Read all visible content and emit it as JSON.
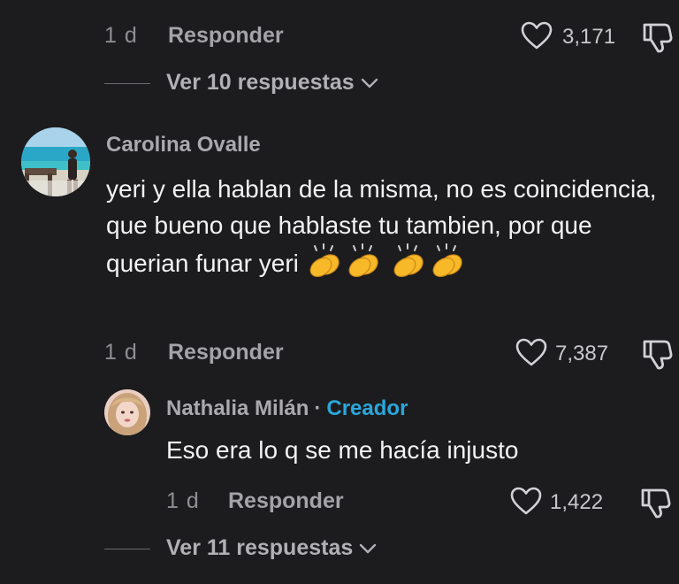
{
  "top_actions": {
    "time": "1 d",
    "reply_label": "Responder",
    "like_count": "3,171"
  },
  "view_replies_1": {
    "label": "Ver 10 respuestas"
  },
  "comment": {
    "username": "Carolina Ovalle",
    "text": "yeri y ella hablan de la misma, no es coincidencia, que bueno que hablaste tu tambien, por que querian funar yeri",
    "time": "1 d",
    "reply_label": "Responder",
    "like_count": "7,387"
  },
  "reply": {
    "username": "Nathalia Milán",
    "separator": "·",
    "badge": "Creador",
    "text": "Eso era lo q se me hacía injusto",
    "time": "1 d",
    "reply_label": "Responder",
    "like_count": "1,422"
  },
  "view_replies_2": {
    "label": "Ver 11 respuestas"
  },
  "icons": {
    "like": "heart-outline-icon",
    "dislike": "thumbs-down-icon",
    "expand": "chevron-down-icon",
    "emoji": "clapping-hands-emoji"
  },
  "colors": {
    "background": "#1c1c1e",
    "creator_badge": "#2aa7dd",
    "muted_text": "#8e8e93"
  }
}
